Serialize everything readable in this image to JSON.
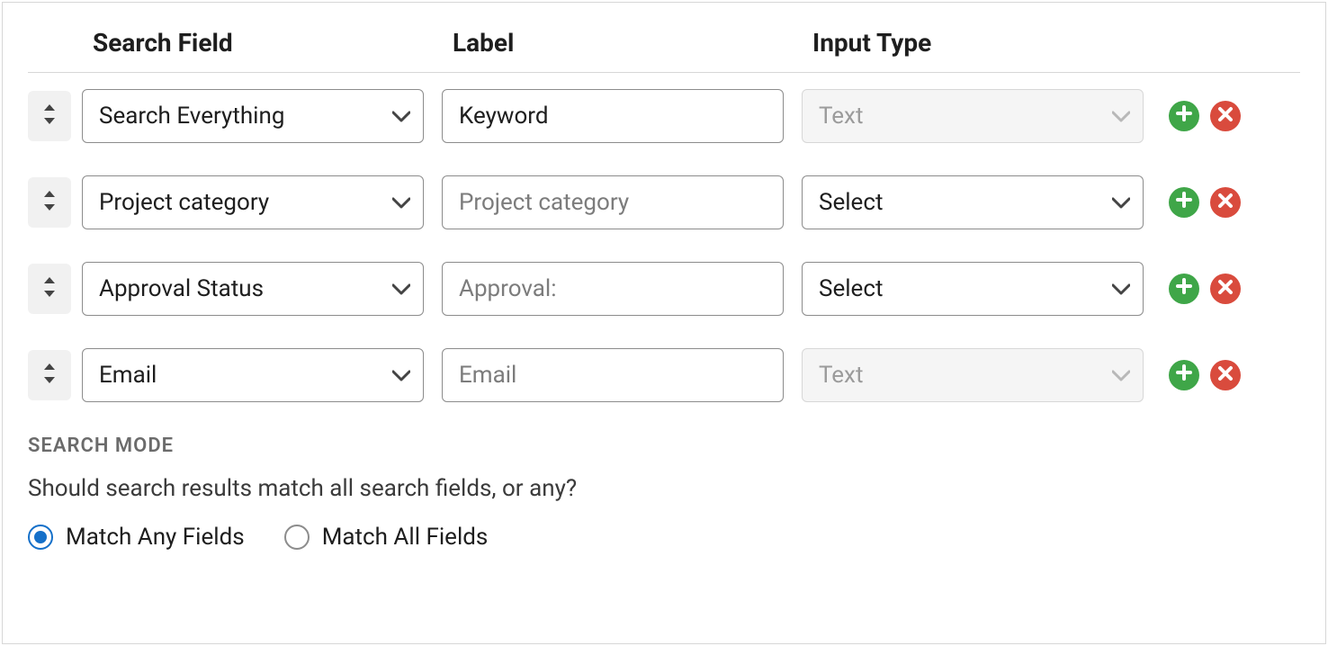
{
  "headers": {
    "field": "Search Field",
    "label": "Label",
    "type": "Input Type"
  },
  "rows": [
    {
      "field": "Search Everything",
      "label_value": "Keyword",
      "label_placeholder": "",
      "type": "Text",
      "type_disabled": true
    },
    {
      "field": "Project category",
      "label_value": "",
      "label_placeholder": "Project category",
      "type": "Select",
      "type_disabled": false
    },
    {
      "field": "Approval Status",
      "label_value": "",
      "label_placeholder": "Approval:",
      "type": "Select",
      "type_disabled": false
    },
    {
      "field": "Email",
      "label_value": "",
      "label_placeholder": "Email",
      "type": "Text",
      "type_disabled": true
    }
  ],
  "search_mode": {
    "title": "SEARCH MODE",
    "desc": "Should search results match all search fields, or any?",
    "options": {
      "any": "Match Any Fields",
      "all": "Match All Fields"
    },
    "selected": "any"
  }
}
